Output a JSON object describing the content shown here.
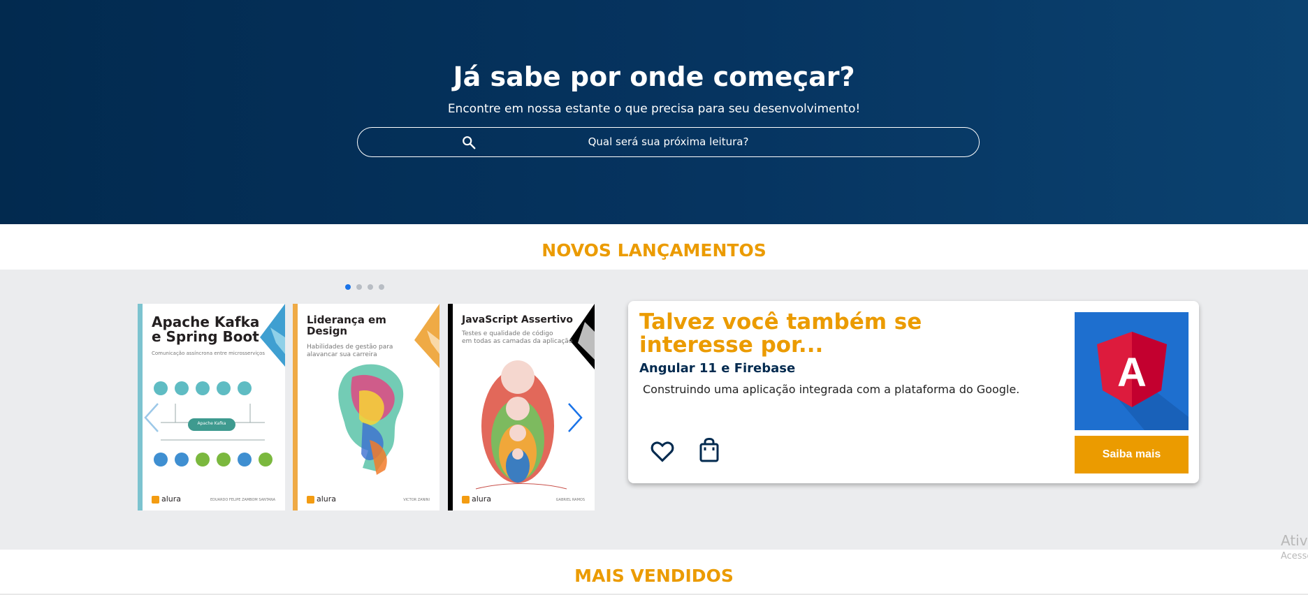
{
  "hero": {
    "title": "Já sabe por onde começar?",
    "subtitle": "Encontre em nossa estante o que precisa para seu desenvolvimento!",
    "search_placeholder": "Qual será sua próxima leitura?"
  },
  "sections": {
    "novos_title": "NOVOS LANÇAMENTOS",
    "vendidos_title": "MAIS VENDIDOS"
  },
  "carousel": {
    "dot_count": 4,
    "active_dot": 1,
    "books": [
      {
        "title_line1": "Apache Kafka",
        "title_line2": "e Spring Boot",
        "subtitle": "Comunicação assíncrona entre microsserviços",
        "center_label": "Apache Kafka",
        "publisher": "alura",
        "author": "EDUARDO FELIPE ZAMBOM SANTANA",
        "accent_color": "#3f9fd1"
      },
      {
        "title_line1": "Liderança em",
        "title_line2": "Design",
        "subtitle_line1": "Habilidades de gestão para",
        "subtitle_line2": "alavancar sua carreira",
        "publisher": "alura",
        "author": "VICTOR ZANINI",
        "accent_color": "#efaa45"
      },
      {
        "title_line1": "JavaScript Assertivo",
        "subtitle_line1": "Testes e qualidade de código",
        "subtitle_line2": "em todas as camadas da aplicação",
        "publisher": "alura",
        "author": "GABRIEL RAMOS",
        "accent_color": "#000000"
      }
    ]
  },
  "recommendation": {
    "title": "Talvez você também se interesse por...",
    "book_title": "Angular 11 e Firebase",
    "description": "Construindo uma aplicação integrada com a plataforma do Google.",
    "cover_letter": "A",
    "button_label": "Saiba mais"
  },
  "watermark": {
    "line1": "Ativa",
    "line2": "Acesse"
  },
  "colors": {
    "accent": "#eb9b00",
    "hero_bg": "#022a4f",
    "band_bg": "#ebecee",
    "active_dot": "#1a73e8",
    "inactive_dot": "#b8bdc4"
  },
  "icons": [
    "search-icon",
    "chevron-left-icon",
    "chevron-right-icon",
    "heart-icon",
    "shopping-bag-icon",
    "angular-logo-icon"
  ]
}
